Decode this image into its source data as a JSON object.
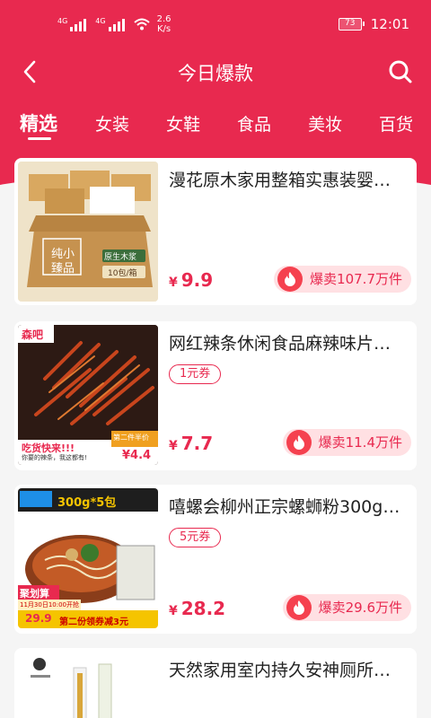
{
  "status_bar": {
    "network_speed_value": "2.6",
    "network_speed_unit": "K/s",
    "signal_tag_1": "4G",
    "signal_tag_2": "4G",
    "battery": "73",
    "time": "12:01"
  },
  "header": {
    "title": "今日爆款"
  },
  "tabs": [
    {
      "label": "精选",
      "active": true
    },
    {
      "label": "女装"
    },
    {
      "label": "女鞋"
    },
    {
      "label": "食品"
    },
    {
      "label": "美妆"
    },
    {
      "label": "百货"
    }
  ],
  "products": [
    {
      "title": "漫花原木家用整箱实惠装婴…",
      "coupon": "",
      "price": "9.9",
      "sold": "爆卖107.7万件",
      "image_text_1": "纯小",
      "image_text_2": "臻品",
      "image_text_3": "原生木浆",
      "image_text_4": "10包/箱"
    },
    {
      "title": "网红辣条休闲食品麻辣味片…",
      "coupon": "1元券",
      "price": "7.7",
      "sold": "爆卖11.4万件",
      "image_text_1": "森吧",
      "image_text_2": "吃货快来!!!",
      "image_text_3": "你要的辣条，我这都有!",
      "image_text_4": "第二件半价",
      "image_text_5": "¥4.4"
    },
    {
      "title": "嘻螺会柳州正宗螺蛳粉300g…",
      "coupon": "5元券",
      "price": "28.2",
      "sold": "爆卖29.6万件",
      "image_text_1": "300g*5包",
      "image_text_2": "聚划算",
      "image_text_3": "11月30日10:00开抢",
      "image_text_4": "29.9",
      "image_text_5": "第二份领券减3元"
    },
    {
      "title": "天然家用室内持久安神厕所…",
      "coupon": "",
      "price": "",
      "sold": ""
    }
  ],
  "currency_symbol": "¥",
  "colors": {
    "brand": "#e8294f",
    "sold_bg": "#ffe0e3",
    "background": "#f5f5f5"
  }
}
